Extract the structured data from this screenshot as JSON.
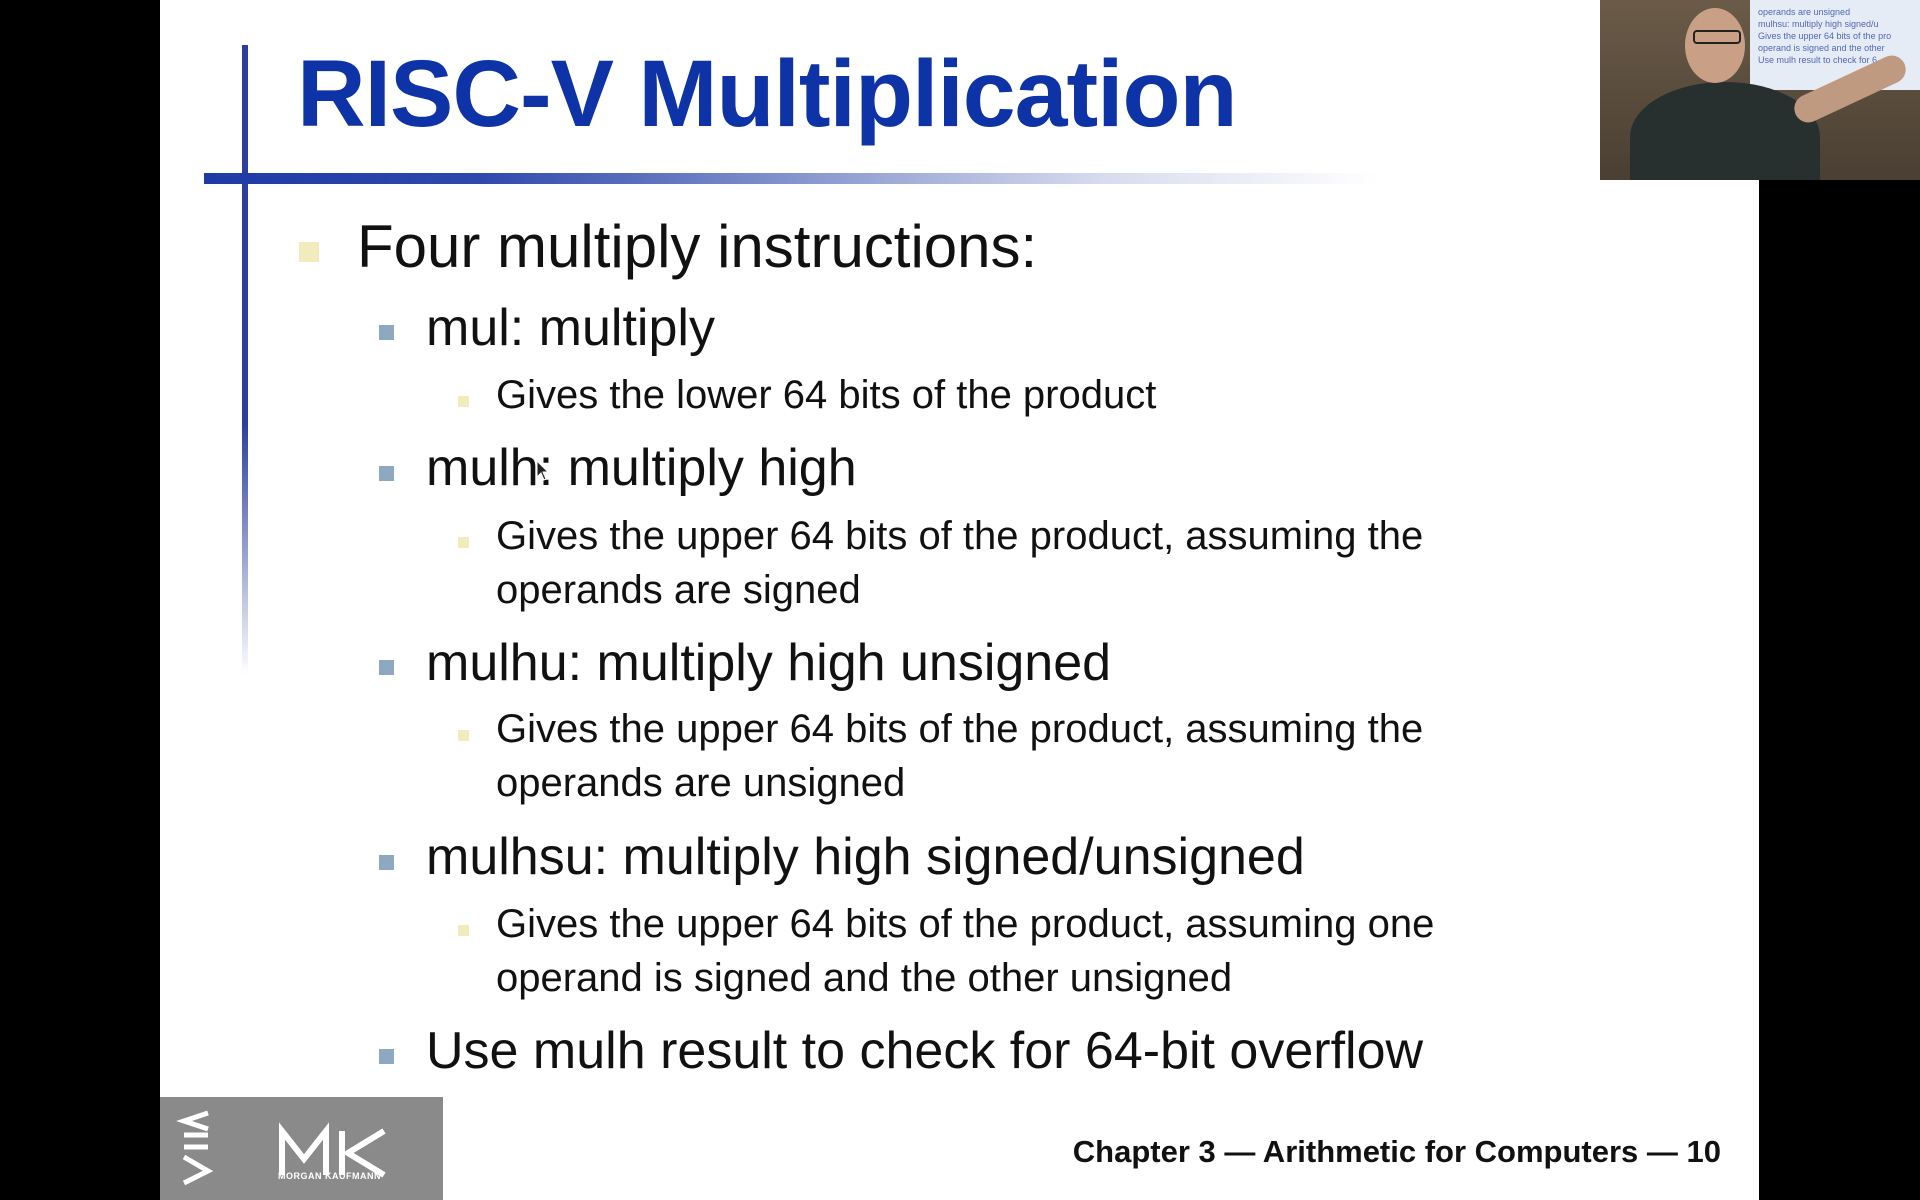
{
  "slide": {
    "title": "RISC-V Multiplication",
    "bullets": {
      "main": "Four multiply instructions:",
      "mul": {
        "label": "mul:  multiply",
        "sub": "Gives the lower 64 bits of the product"
      },
      "mulh": {
        "label": "mulh:  multiply high",
        "sub_line1": "Gives the upper 64 bits of the product, assuming the",
        "sub_line2": "operands are signed"
      },
      "mulhu": {
        "label": "mulhu:  multiply high unsigned",
        "sub_line1": "Gives the upper 64 bits of the product, assuming the",
        "sub_line2": "operands are unsigned"
      },
      "mulhsu": {
        "label": "mulhsu:  multiply high signed/unsigned",
        "sub_line1": "Gives the upper 64 bits of the product, assuming one",
        "sub_line2": "operand is signed and the other unsigned"
      },
      "overflow": "Use mulh result to check for 64-bit overflow"
    },
    "footer": {
      "chapter_text": "Chapter 3 — Arithmetic for Computers — 10",
      "publisher_logo": "MORGAN KAUFMANN"
    }
  },
  "webcam": {
    "screen_lines": [
      "operands are unsigned",
      "mulhsu:  multiply high signed/u",
      "Gives the upper 64 bits of the pro",
      "operand is signed and the other",
      "Use mulh result to check for 6"
    ]
  },
  "colors": {
    "title": "#0e33a6",
    "accent_bar": "#1d3aa6",
    "bullet_primary": "#f2ecbd",
    "bullet_secondary": "#8fa8c2",
    "footer_logo_bg": "#8a8a8a"
  },
  "icons": [
    "mouse-cursor-icon",
    "morgan-kaufmann-logo"
  ]
}
